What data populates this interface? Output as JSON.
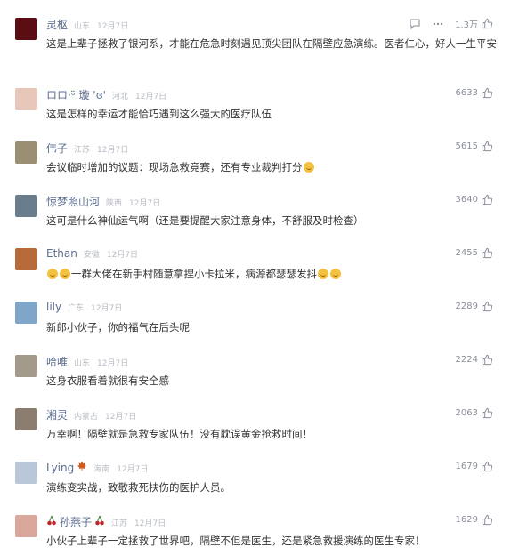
{
  "comments": [
    {
      "name": "灵枢",
      "loc": "山东",
      "date": "12月7日",
      "text": "这是上辈子拯救了银河系，才能在危急时刻遇见顶尖团队在隔壁应急演练。医者仁心，好人一生平安",
      "likes": "1.3万",
      "avatar_color": "#5a0d12"
    },
    {
      "name": "ロロ·ᵕ̈ 璇 'ɞ'",
      "loc": "河北",
      "date": "12月7日",
      "text": "这是怎样的幸运才能恰巧遇到这么强大的医疗队伍",
      "likes": "6633",
      "avatar_color": "#e8c7bb"
    },
    {
      "name": "伟子",
      "loc": "江苏",
      "date": "12月7日",
      "text": "会议临时增加的议题：现场急救竞赛，还有专业裁判打分",
      "likes": "5615",
      "avatar_color": "#9a8f72"
    },
    {
      "name": "惊梦照山河",
      "loc": "陕西",
      "date": "12月7日",
      "text": "这可是什么神仙运气啊（还是要提醒大家注意身体，不舒服及时检查）",
      "likes": "3640",
      "avatar_color": "#6a7d8c"
    },
    {
      "name": "Ethan",
      "loc": "安徽",
      "date": "12月7日",
      "text": "一群大佬在新手村随意拿捏小卡拉米，病源都瑟瑟发抖",
      "likes": "2455",
      "avatar_color": "#b86a3a"
    },
    {
      "name": "lily",
      "loc": "广东",
      "date": "12月7日",
      "text": "新郎小伙子，你的福气在后头呢",
      "likes": "2289",
      "avatar_color": "#7fa6c9"
    },
    {
      "name": "哈唯",
      "loc": "山东",
      "date": "12月7日",
      "text": "这身衣服看着就很有安全感",
      "likes": "2224",
      "avatar_color": "#a39a8b"
    },
    {
      "name": "湘灵",
      "loc": "内蒙古",
      "date": "12月7日",
      "text": "万幸啊！隔壁就是急救专家队伍！没有耽误黄金抢救时间！",
      "likes": "2063",
      "avatar_color": "#8b7d6f"
    },
    {
      "name": "Lying",
      "loc": "海南",
      "date": "12月7日",
      "text": "演练变实战，致敬救死扶伤的医护人员。",
      "likes": "1679",
      "avatar_color": "#b9c7d9"
    },
    {
      "name": "孙燕子",
      "loc": "江苏",
      "date": "12月7日",
      "text": "小伙子上辈子一定拯救了世界吧，隔壁不但是医生，还是紧急救援演练的医生专家！",
      "likes": "1629",
      "avatar_color": "#d9a79b"
    }
  ],
  "icons": [
    "comment-icon",
    "more-icon",
    "thumb-up-icon",
    "grin-emoji",
    "maple-leaf-badge",
    "cherry-badge"
  ]
}
